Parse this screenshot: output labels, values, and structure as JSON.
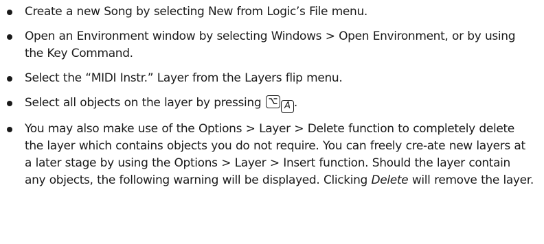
{
  "bullets": [
    "Create a new Song by selecting New from Logic’s File menu.",
    "Open an Environment window by selecting Windows > Open Environment, or by using the Key Command.",
    "Select the “MIDI Instr.” Layer from the Layers flip menu.",
    {
      "text": "Select all objects on the layer by pressing",
      "keys": [
        "option-key-icon",
        "A"
      ],
      "end": "."
    },
    {
      "text_before": "You may also make use of the Options > Layer > Delete function to completely delete the layer which contains objects you do not require. You can freely cre-ate new layers at a later stage by using the Options > Layer > Insert function. Should the layer contain any objects, the following warning will be displayed. Clicking ",
      "emphasis": "Delete",
      "text_after": " will remove the layer."
    }
  ]
}
